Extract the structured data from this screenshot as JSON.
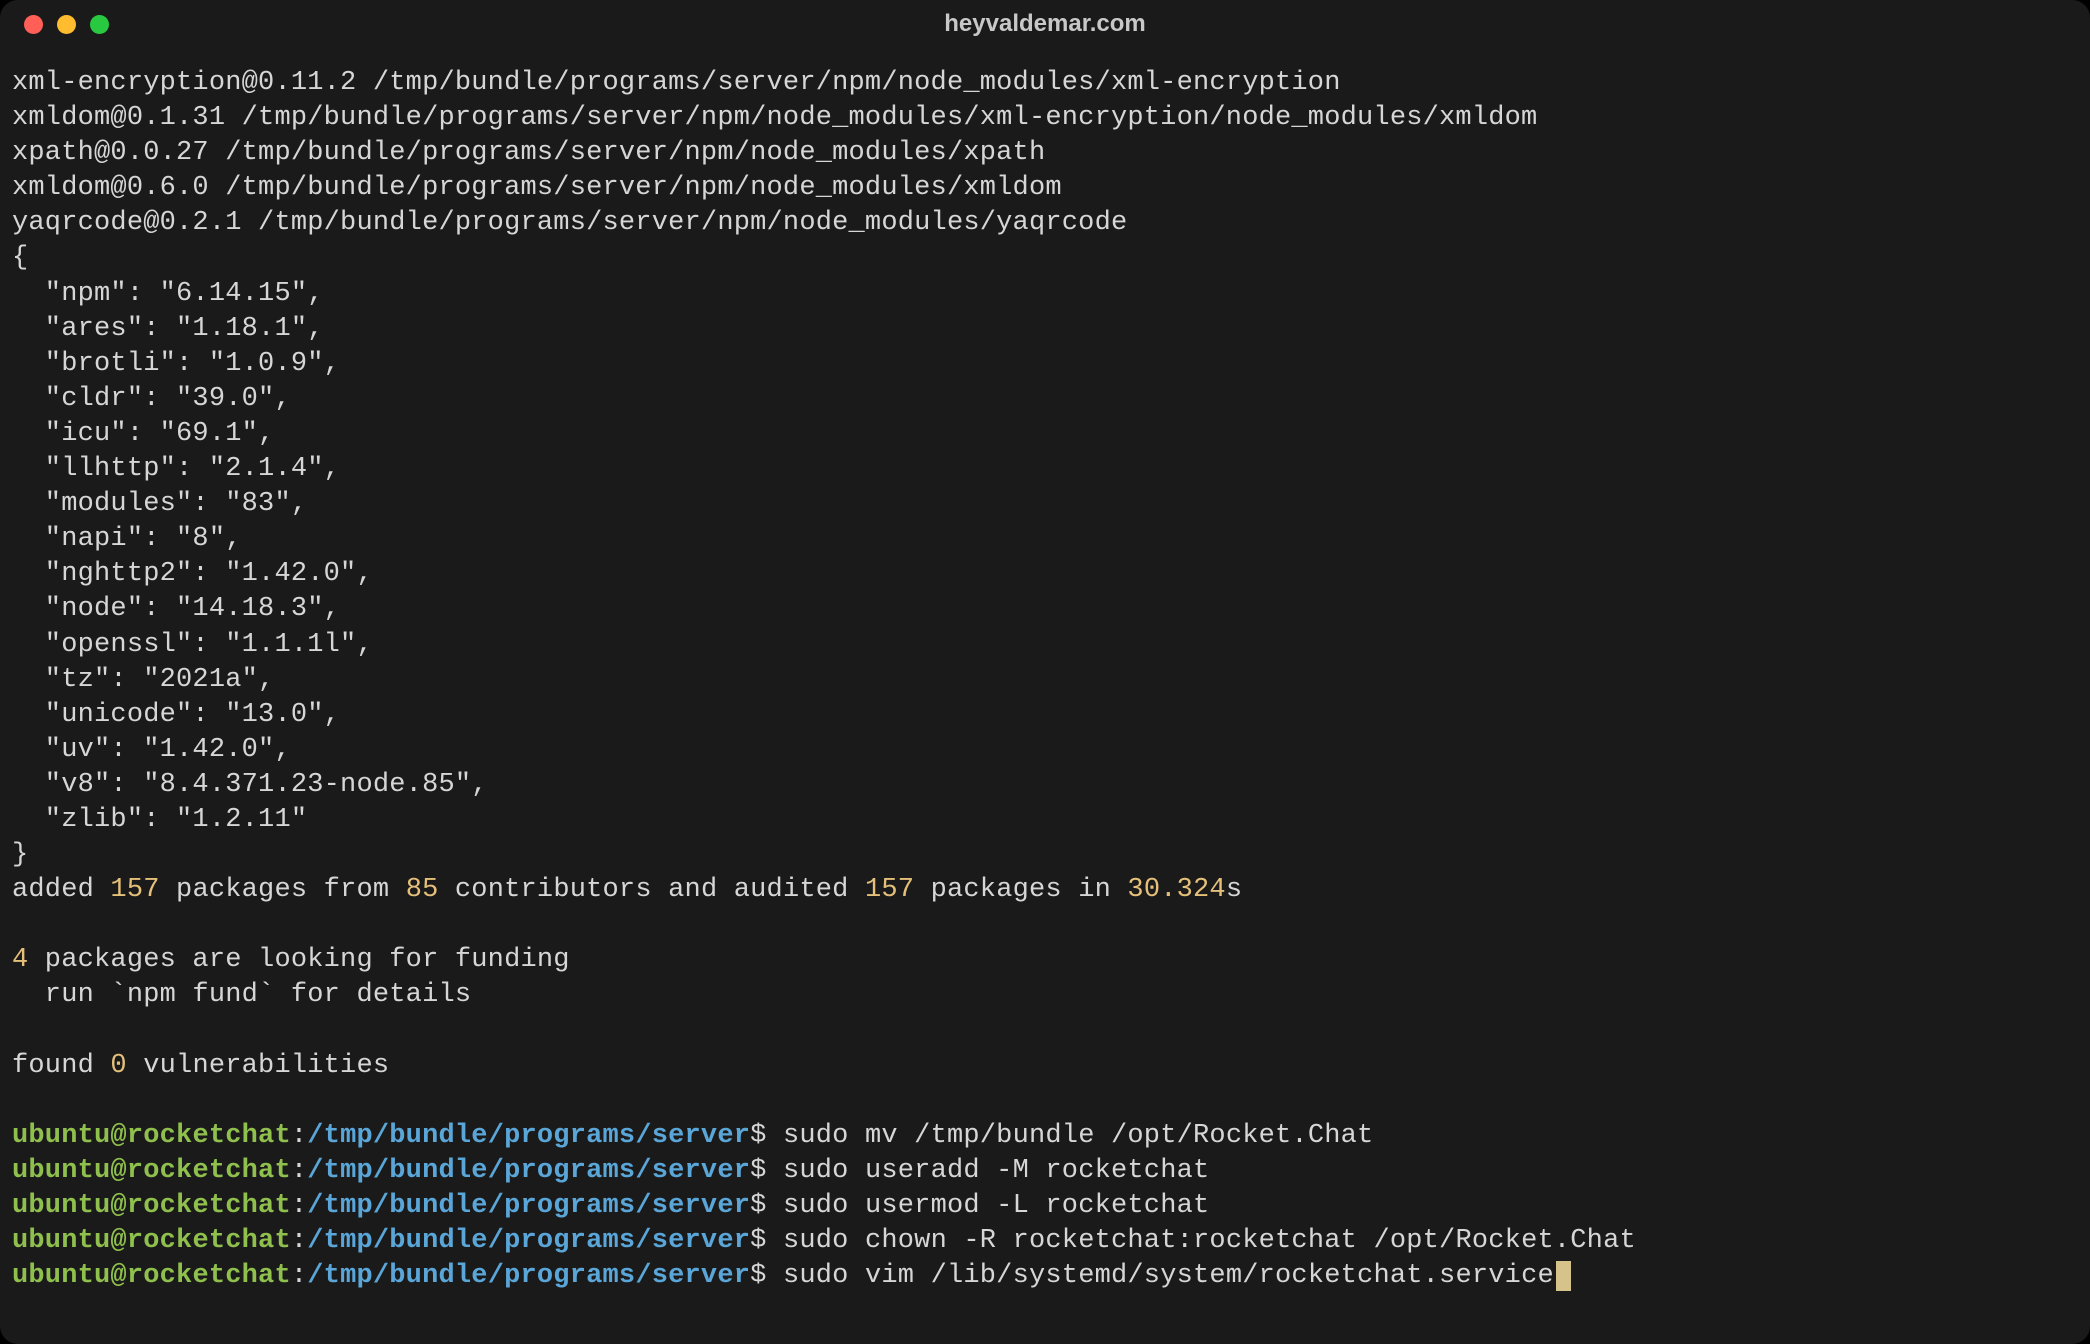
{
  "window": {
    "title": "heyvaldemar.com"
  },
  "output": {
    "pkg_lines": [
      "xml-encryption@0.11.2 /tmp/bundle/programs/server/npm/node_modules/xml-encryption",
      "xmldom@0.1.31 /tmp/bundle/programs/server/npm/node_modules/xml-encryption/node_modules/xmldom",
      "xpath@0.0.27 /tmp/bundle/programs/server/npm/node_modules/xpath",
      "xmldom@0.6.0 /tmp/bundle/programs/server/npm/node_modules/xmldom",
      "yaqrcode@0.2.1 /tmp/bundle/programs/server/npm/node_modules/yaqrcode"
    ],
    "json_open": "{",
    "json_entries": [
      "  \"npm\": \"6.14.15\",",
      "  \"ares\": \"1.18.1\",",
      "  \"brotli\": \"1.0.9\",",
      "  \"cldr\": \"39.0\",",
      "  \"icu\": \"69.1\",",
      "  \"llhttp\": \"2.1.4\",",
      "  \"modules\": \"83\",",
      "  \"napi\": \"8\",",
      "  \"nghttp2\": \"1.42.0\",",
      "  \"node\": \"14.18.3\",",
      "  \"openssl\": \"1.1.1l\",",
      "  \"tz\": \"2021a\",",
      "  \"unicode\": \"13.0\",",
      "  \"uv\": \"1.42.0\",",
      "  \"v8\": \"8.4.371.23-node.85\",",
      "  \"zlib\": \"1.2.11\""
    ],
    "json_close": "}",
    "summary_prefix": "added ",
    "summary_n1": "157",
    "summary_mid1": " packages from ",
    "summary_n2": "85",
    "summary_mid2": " contributors and audited ",
    "summary_n3": "157",
    "summary_mid3": " packages in ",
    "summary_time": "30.324",
    "summary_suffix": "s",
    "blank": "",
    "fund_prefix": "",
    "fund_n": "4",
    "fund_text": " packages are looking for funding",
    "fund_hint": "  run `npm fund` for details",
    "vuln_prefix": "found ",
    "vuln_n": "0",
    "vuln_suffix": " vulnerabilities"
  },
  "prompt": {
    "user": "ubuntu",
    "at": "@",
    "host": "rocketchat",
    "colon": ":",
    "path": "/tmp/bundle/programs/server",
    "sym": "$ "
  },
  "commands": {
    "c1": "sudo mv /tmp/bundle /opt/Rocket.Chat",
    "c2": "sudo useradd -M rocketchat",
    "c3": "sudo usermod -L rocketchat",
    "c4": "sudo chown -R rocketchat:rocketchat /opt/Rocket.Chat",
    "c5": "sudo vim /lib/systemd/system/rocketchat.service"
  }
}
